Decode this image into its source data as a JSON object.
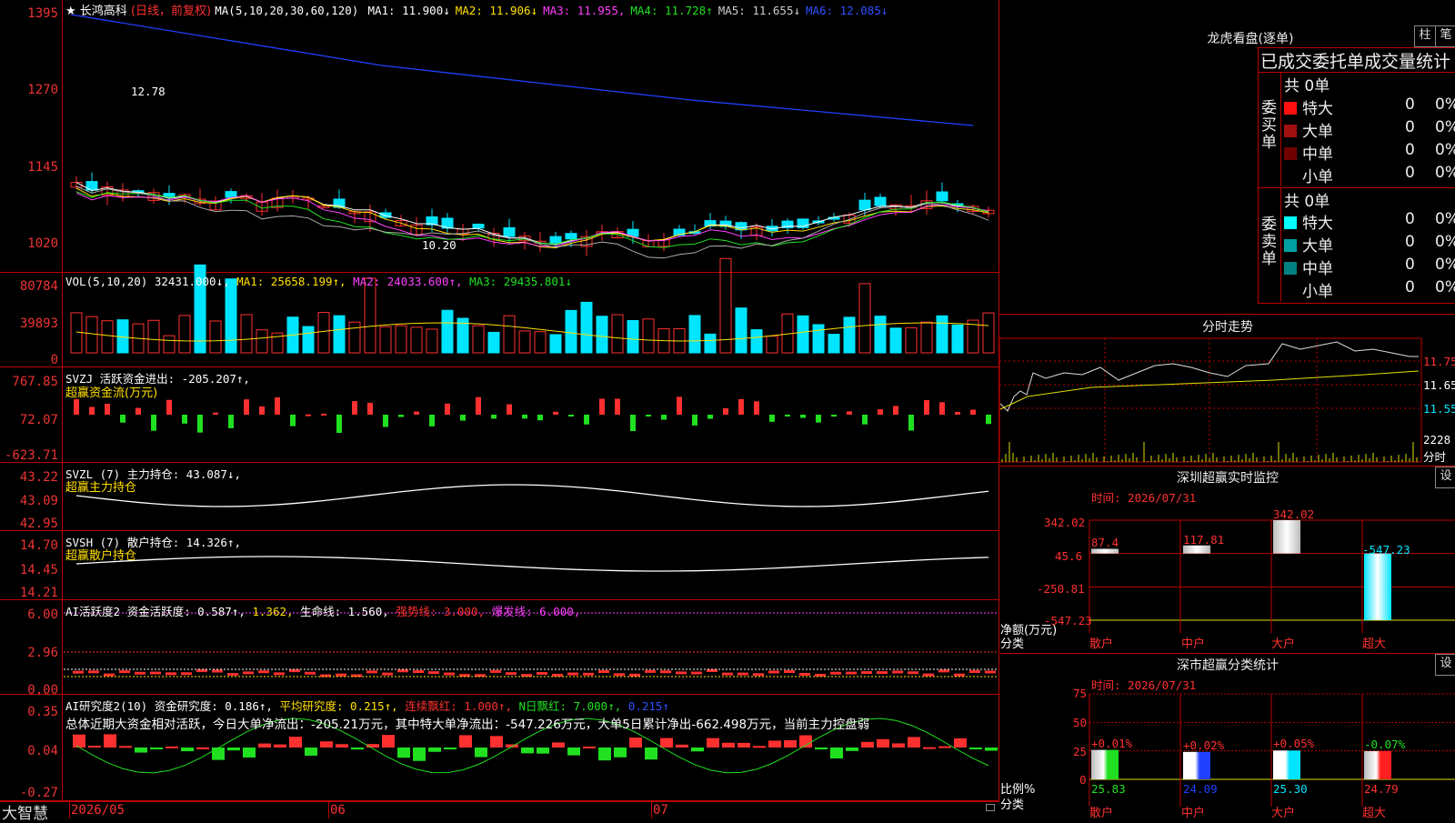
{
  "header": {
    "star": "★",
    "name": "长鸿高科",
    "mode": "(日线，前复权)",
    "ma_label": "MA(5,10,20,30,60,120)",
    "ma": [
      {
        "label": "MA1: 11.900↓",
        "color": "#ffffff"
      },
      {
        "label": "MA2: 11.906↓",
        "color": "#ffe000"
      },
      {
        "label": "MA3: 11.955,",
        "color": "#ff40ff"
      },
      {
        "label": "MA4: 11.728↑",
        "color": "#20e020"
      },
      {
        "label": "MA5: 11.655↓",
        "color": "#cccccc"
      },
      {
        "label": "MA6: 12.085↓",
        "color": "#3050ff"
      }
    ]
  },
  "price_axis": [
    "1395",
    "1270",
    "1145",
    "1020"
  ],
  "price_annotations": {
    "high": "12.78",
    "low": "10.20"
  },
  "vol": {
    "title": "VOL(5,10,20)",
    "value": "32431.000↓,",
    "ma1": "MA1: 25658.199↑,",
    "ma2": "MA2: 24033.600↑,",
    "ma3": "MA3: 29435.801↓",
    "axis": [
      "80784",
      "39893",
      "0"
    ]
  },
  "svzj": {
    "title": "SVZJ  活跃资金进出: -205.207↑,",
    "subtitle": "超赢资金流(万元)",
    "axis": [
      "767.85",
      "72.07",
      "-623.71"
    ]
  },
  "svzl": {
    "title": "SVZL (7) 主力持仓: 43.087↓,",
    "subtitle": "超赢主力持仓",
    "axis": [
      "43.22",
      "43.09",
      "42.95"
    ]
  },
  "svsh": {
    "title": "SVSH (7) 散户持仓: 14.326↑,",
    "subtitle": "超赢散户持仓",
    "axis": [
      "14.70",
      "14.45",
      "14.21"
    ]
  },
  "ai1": {
    "t1": "AI活跃度2 资金活跃度: 0.587↑,",
    "t2": "1.362,",
    "t3": "生命线: 1.560,",
    "t4": "强势线: 3.000,",
    "t5": "爆发线: 6.000,",
    "axis": [
      "6.00",
      "2.96",
      "0.00"
    ]
  },
  "ai2": {
    "t1": "AI研究度2(10) 资金研究度: 0.186↑,",
    "t2": "平均研究度: 0.215↑,",
    "t3": "连续飘红: 1.000↑,",
    "t4": "N日飘红: 7.000↑,",
    "t5": "0.215↑",
    "summary": "总体近期大资金相对活跃，今日大单净流出：-205.21万元，其中特大单净流出：-547.226万元，大单5日累计净出-662.498万元，当前主力控盘弱",
    "axis": [
      "0.35",
      "0.04",
      "-0.27"
    ]
  },
  "bottom": {
    "logo": "大智慧",
    "dates": [
      "2026/05",
      "06",
      "07"
    ]
  },
  "lhb": {
    "title": "龙虎看盘(逐单)",
    "btn1": "柱",
    "btn2": "笔",
    "header": "已成交委托单成交量统计",
    "buy_label": "委买单",
    "sell_label": "委卖单",
    "buy_total": "共 0单",
    "sell_total": "共 0单",
    "buy_rows": [
      {
        "name": "特大",
        "count": "0",
        "pct": "0%",
        "color": "#ff1010"
      },
      {
        "name": "大单",
        "count": "0",
        "pct": "0%",
        "color": "#a01010"
      },
      {
        "name": "中单",
        "count": "0",
        "pct": "0%",
        "color": "#700000"
      },
      {
        "name": "小单",
        "count": "0",
        "pct": "0%",
        "color": ""
      }
    ],
    "sell_rows": [
      {
        "name": "特大",
        "count": "0",
        "pct": "0%",
        "color": "#00ffff"
      },
      {
        "name": "大单",
        "count": "0",
        "pct": "0%",
        "color": "#00a0a0"
      },
      {
        "name": "中单",
        "count": "0",
        "pct": "0%",
        "color": "#008080"
      },
      {
        "name": "小单",
        "count": "0",
        "pct": "0%",
        "color": ""
      }
    ]
  },
  "intraday": {
    "title": "分时走势",
    "axis": [
      "11.75",
      "11.65",
      "11.55"
    ],
    "vol": "2228",
    "unit": "分时"
  },
  "monitor": {
    "title": "深圳超赢实时监控",
    "btn": "设",
    "time": "时间: 2026/07/31",
    "axis": [
      "342.02",
      "45.6",
      "-250.81",
      "-547.23"
    ],
    "ylabel": "净额(万元)",
    "xlabel": "分类",
    "categories": [
      "散户",
      "中户",
      "大户",
      "超大"
    ],
    "values": [
      "87.4",
      "117.81",
      "342.02",
      "-547.23"
    ]
  },
  "stats": {
    "title": "深市超赢分类统计",
    "btn": "设",
    "time": "时间: 2026/07/31",
    "axis": [
      "75",
      "50",
      "25",
      "0"
    ],
    "ylabel": "比例%",
    "xlabel": "分类",
    "categories": [
      "散户",
      "中户",
      "大户",
      "超大"
    ],
    "pcts": [
      "25.83",
      "24.09",
      "25.30",
      "24.79"
    ],
    "changes": [
      "+0.01%",
      "+0.02%",
      "+0.05%",
      "-0.07%"
    ]
  },
  "chart_data": [
    {
      "type": "bar",
      "title": "深圳超赢实时监控",
      "categories": [
        "散户",
        "中户",
        "大户",
        "超大"
      ],
      "values": [
        87.4,
        117.81,
        342.02,
        -547.23
      ],
      "ylabel": "净额(万元)",
      "ylim": [
        -547.23,
        342.02
      ]
    },
    {
      "type": "bar",
      "title": "深市超赢分类统计",
      "categories": [
        "散户",
        "中户",
        "大户",
        "超大"
      ],
      "values": [
        25.83,
        24.09,
        25.3,
        24.79
      ],
      "ylabel": "比例%",
      "ylim": [
        0,
        75
      ]
    }
  ]
}
